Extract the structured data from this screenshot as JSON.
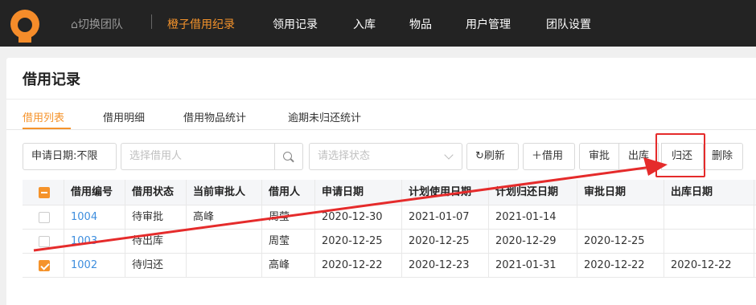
{
  "nav": {
    "team_switch": "切换团队",
    "items": [
      "橙子借用纪录",
      "领用记录",
      "入库",
      "物品",
      "用户管理",
      "团队设置"
    ]
  },
  "page": {
    "title": "借用记录"
  },
  "tabs": [
    "借用列表",
    "借用明细",
    "借用物品统计",
    "逾期未归还统计"
  ],
  "toolbar": {
    "date_filter": "申请日期:不限",
    "borrower_placeholder": "选择借用人",
    "status_placeholder": "请选择状态",
    "refresh": "刷新",
    "borrow": "借用",
    "approve": "审批",
    "outbound": "出库",
    "return": "归还",
    "delete": "删除"
  },
  "table": {
    "headers": [
      "借用编号",
      "借用状态",
      "当前审批人",
      "借用人",
      "申请日期",
      "计划使用日期",
      "计划归还日期",
      "审批日期",
      "出库日期"
    ],
    "rows": [
      [
        "1004",
        "待审批",
        "高峰",
        "周莹",
        "2020-12-30",
        "2021-01-07",
        "2021-01-14",
        "",
        ""
      ],
      [
        "1003",
        "待出库",
        "",
        "周莹",
        "2020-12-25",
        "2020-12-25",
        "2020-12-29",
        "2020-12-25",
        ""
      ],
      [
        "1002",
        "待归还",
        "",
        "高峰",
        "2020-12-22",
        "2020-12-23",
        "2021-01-31",
        "2020-12-22",
        "2020-12-22"
      ]
    ]
  },
  "colors": {
    "accent": "#f5932b",
    "link": "#3e8ede",
    "annotation": "#e52b2b"
  }
}
